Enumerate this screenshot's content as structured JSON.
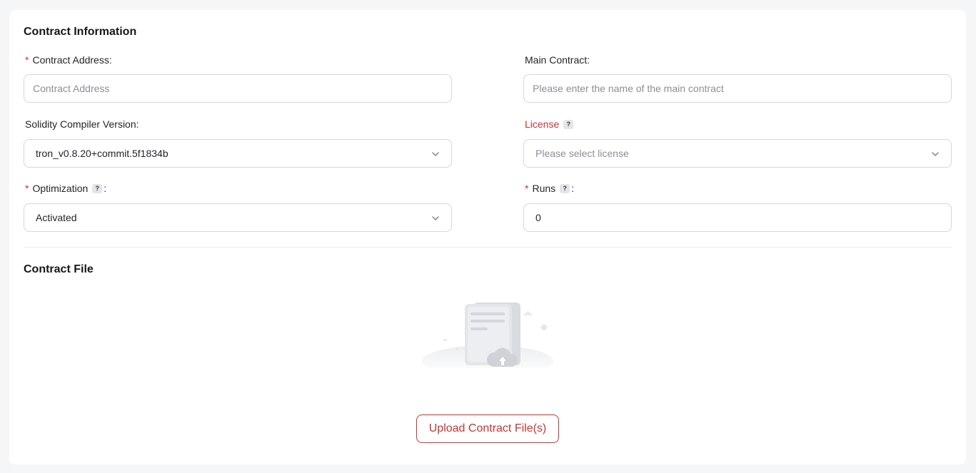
{
  "contract_info": {
    "title": "Contract Information",
    "address": {
      "required_mark": "*",
      "label": "Contract Address:",
      "placeholder": "Contract Address"
    },
    "main_contract": {
      "label": "Main Contract:",
      "placeholder": "Please enter the name of the main contract"
    },
    "compiler": {
      "label": "Solidity Compiler Version:",
      "value": "tron_v0.8.20+commit.5f1834b"
    },
    "license": {
      "label": "License",
      "help": "?",
      "placeholder": "Please select license"
    },
    "optimization": {
      "required_mark": "*",
      "label": "Optimization",
      "help": "?",
      "colon": ":",
      "value": "Activated"
    },
    "runs": {
      "required_mark": "*",
      "label": "Runs",
      "help": "?",
      "colon": ":",
      "value": "0"
    }
  },
  "contract_file": {
    "title": "Contract File",
    "upload_label": "Upload Contract File(s)"
  },
  "colors": {
    "accent": "#c23631",
    "border": "#d4d7dc",
    "background": "#f5f6f8"
  },
  "icons": {
    "dropdown": "chevron-down-icon",
    "help": "question-mark-icon",
    "empty": "document-upload-illustration"
  }
}
